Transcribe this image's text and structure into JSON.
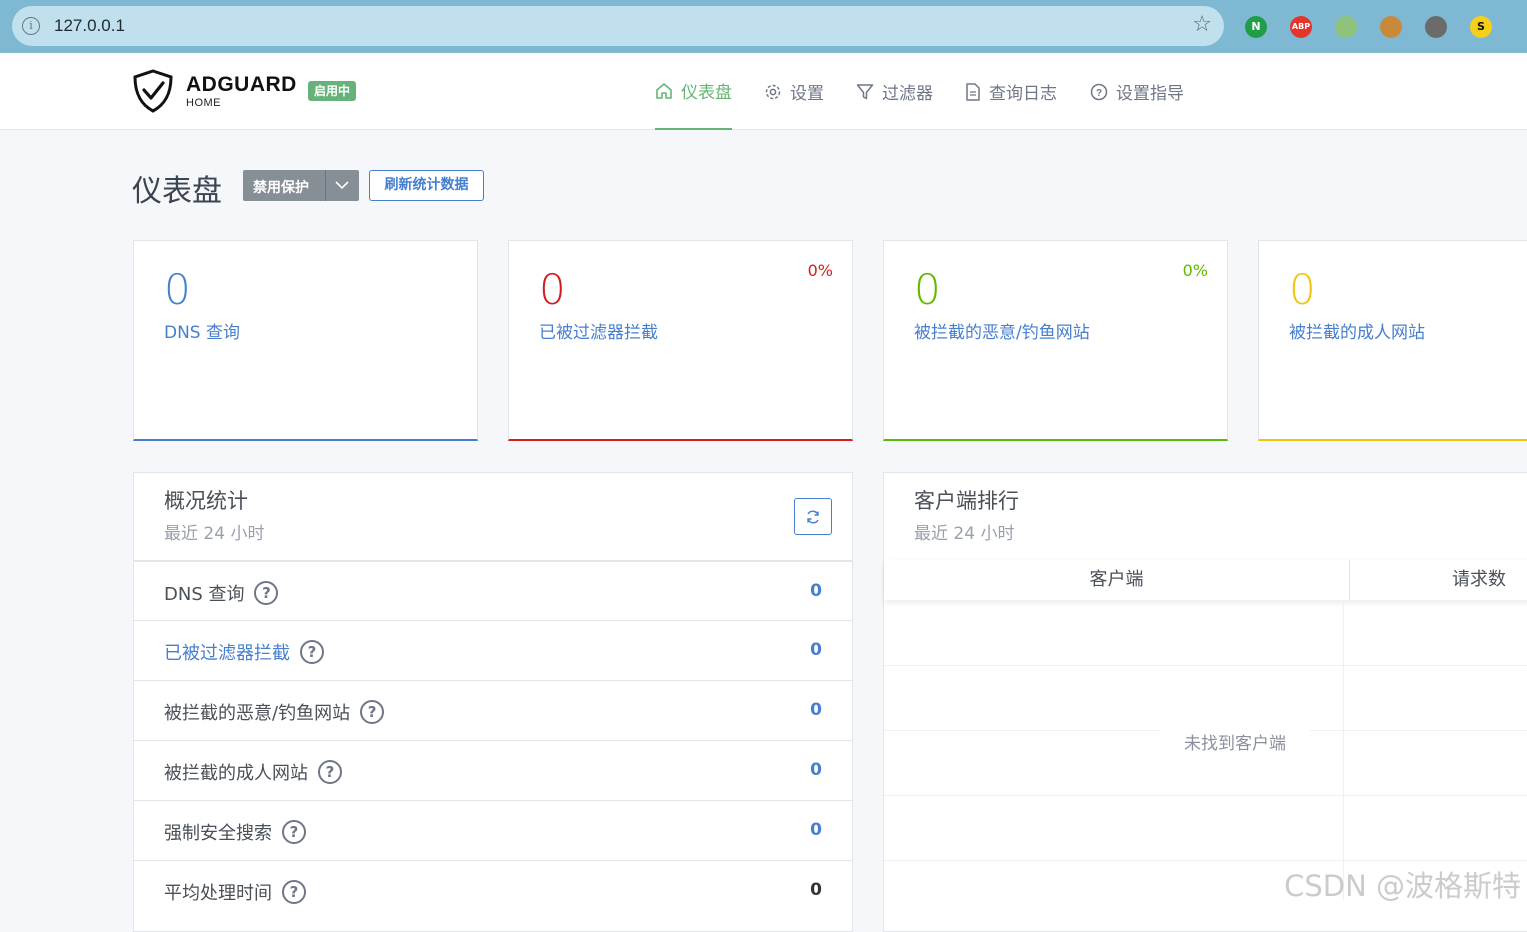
{
  "browser": {
    "url": "127.0.0.1",
    "extensions": [
      {
        "name": "n-extension-icon",
        "glyph": "N",
        "color": "#1f9e47"
      },
      {
        "name": "adblock-plus-icon",
        "glyph": "ABP",
        "color": "#e4352b"
      },
      {
        "name": "green-circle-extension-icon",
        "glyph": "",
        "color": "#8fc27a"
      },
      {
        "name": "cookie-extension-icon",
        "glyph": "",
        "color": "#c88a3a"
      },
      {
        "name": "monkey-extension-icon",
        "glyph": "",
        "color": "#6b6b6b"
      },
      {
        "name": "s-extension-icon",
        "glyph": "S",
        "color": "#f5d018"
      }
    ]
  },
  "header": {
    "logo_text": "ADGUARD",
    "logo_sub": "HOME",
    "status_badge": "启用中",
    "nav": [
      {
        "label": "仪表盘",
        "icon": "home-icon",
        "active": true
      },
      {
        "label": "设置",
        "icon": "gear-icon",
        "active": false
      },
      {
        "label": "过滤器",
        "icon": "filter-icon",
        "active": false
      },
      {
        "label": "查询日志",
        "icon": "document-icon",
        "active": false
      },
      {
        "label": "设置指导",
        "icon": "help-icon",
        "active": false
      }
    ]
  },
  "page": {
    "title": "仪表盘",
    "disable_button": "禁用保护",
    "refresh_button": "刷新统计数据"
  },
  "cards": [
    {
      "value": "0",
      "label": "DNS 查询",
      "percent": "",
      "color": "#467fcf"
    },
    {
      "value": "0",
      "label": "已被过滤器拦截",
      "percent": "0%",
      "color": "#cd201f"
    },
    {
      "value": "0",
      "label": "被拦截的恶意/钓鱼网站",
      "percent": "0%",
      "color": "#5eba00"
    },
    {
      "value": "0",
      "label": "被拦截的成人网站",
      "percent": "",
      "color": "#f1c40f"
    }
  ],
  "stats_panel": {
    "title": "概况统计",
    "subtitle": "最近 24 小时",
    "rows": [
      {
        "label": "DNS 查询",
        "value": "0",
        "label_link": false,
        "value_color": "#467fcf"
      },
      {
        "label": "已被过滤器拦截",
        "value": "0",
        "label_link": true,
        "value_color": "#467fcf"
      },
      {
        "label": "被拦截的恶意/钓鱼网站",
        "value": "0",
        "label_link": false,
        "value_color": "#467fcf"
      },
      {
        "label": "被拦截的成人网站",
        "value": "0",
        "label_link": false,
        "value_color": "#467fcf"
      },
      {
        "label": "强制安全搜索",
        "value": "0",
        "label_link": false,
        "value_color": "#467fcf"
      },
      {
        "label": "平均处理时间",
        "value": "0",
        "label_link": false,
        "value_color": "#333333"
      }
    ]
  },
  "clients_panel": {
    "title": "客户端排行",
    "subtitle": "最近 24 小时",
    "col_client": "客户端",
    "col_requests": "请求数",
    "empty_text": "未找到客户端"
  },
  "watermark": "CSDN @波格斯特"
}
